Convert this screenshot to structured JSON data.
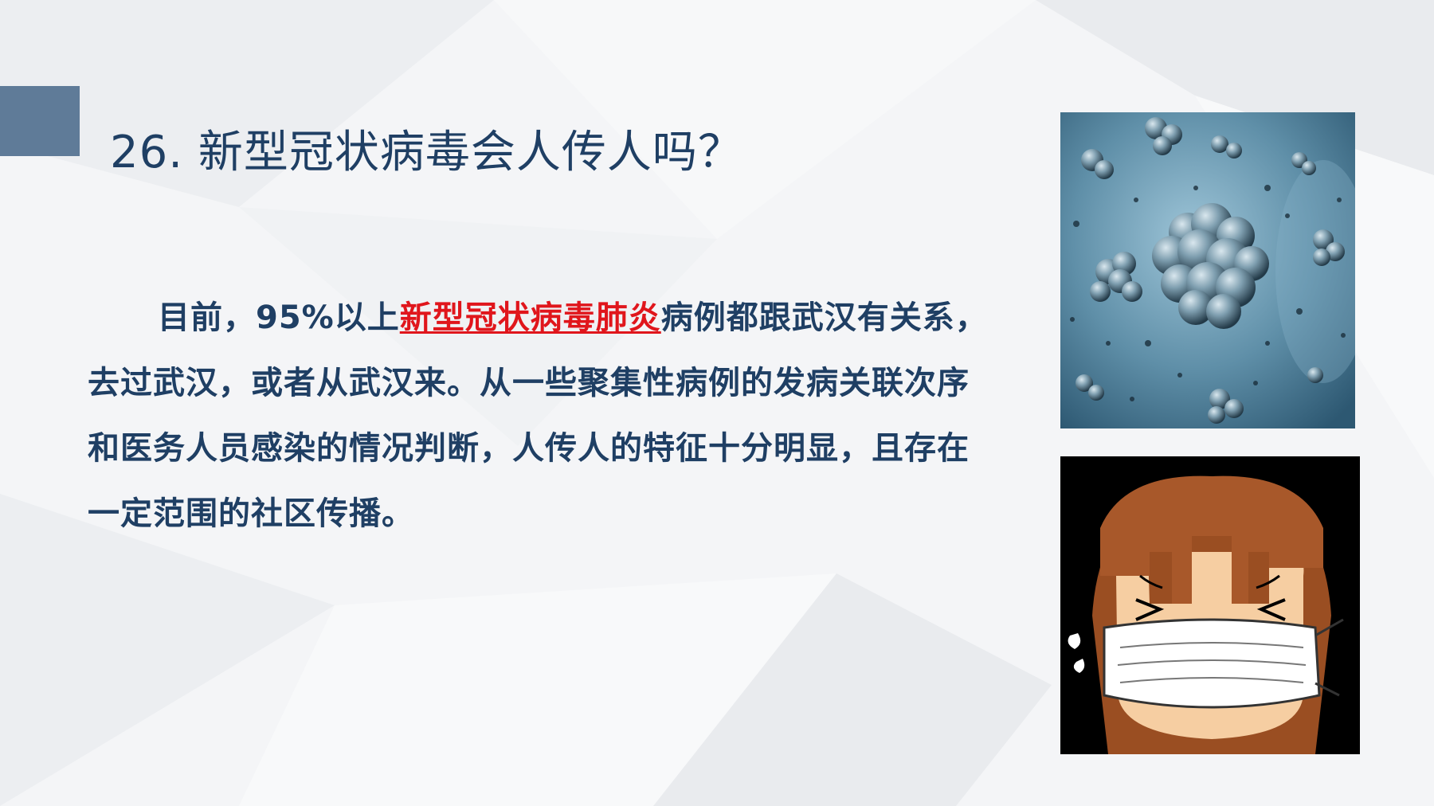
{
  "slide": {
    "title": "26. 新型冠状病毒会人传人吗？",
    "paragraph": {
      "before": "目前，95%以上",
      "highlight": "新型冠状病毒肺炎",
      "after": "病例都跟武汉有关系，去过武汉，或者从武汉来。从一些聚集性病例的发病关联次序和医务人员感染的情况判断，人传人的特征十分明显，且存在一定范围的社区传播。"
    }
  },
  "colors": {
    "title_text": "#1f3f64",
    "highlight_text": "#e0161c",
    "accent_block": "#5f7b98",
    "background": "#f4f5f7"
  },
  "images": {
    "virus": "virus-micrograph-illustration",
    "mask": "cartoon-girl-wearing-mask"
  }
}
